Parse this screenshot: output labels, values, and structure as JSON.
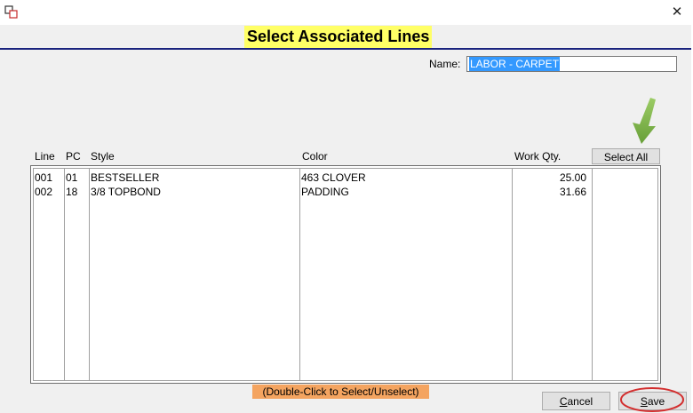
{
  "dialog": {
    "title": "Select Associated Lines",
    "close_glyph": "✕"
  },
  "name_field": {
    "label": "Name:",
    "value": "LABOR - CARPET"
  },
  "table": {
    "headers": [
      "Line",
      "PC",
      "Style",
      "Color",
      "Work Qty."
    ],
    "rows": [
      {
        "line": "001",
        "pc": "01",
        "style": "BESTSELLER",
        "color": "463 CLOVER",
        "qty": "25.00"
      },
      {
        "line": "002",
        "pc": "18",
        "style": "3/8 TOPBOND",
        "color": "PADDING",
        "qty": "31.66"
      }
    ]
  },
  "buttons": {
    "select_all": "Select All",
    "cancel_pre": "",
    "cancel_ul": "C",
    "cancel_post": "ancel",
    "save_pre": "",
    "save_ul": "S",
    "save_post": "ave"
  },
  "hint": "(Double-Click to Select/Unselect)",
  "colors": {
    "title_highlight": "#ffff66",
    "header_rule": "#1a237e",
    "hint_bg": "#f4a460",
    "arrow_green": "#7cb342",
    "annotation_red": "#d32f2f",
    "selection_blue": "#3399ff"
  }
}
